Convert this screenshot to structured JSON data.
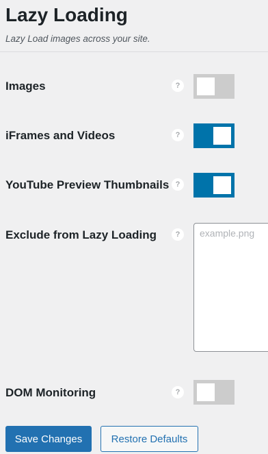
{
  "header": {
    "title": "Lazy Loading",
    "subtitle": "Lazy Load images across your site."
  },
  "settings": {
    "images": {
      "label": "Images",
      "help": "?",
      "enabled": false
    },
    "iframes_videos": {
      "label": "iFrames and Videos",
      "help": "?",
      "enabled": true
    },
    "youtube_thumbnails": {
      "label": "YouTube Preview Thumbnails",
      "help": "?",
      "enabled": true
    },
    "exclude": {
      "label": "Exclude from Lazy Loading",
      "help": "?",
      "value": "",
      "placeholder": "example.png"
    },
    "dom_monitoring": {
      "label": "DOM Monitoring",
      "help": "?",
      "enabled": false
    }
  },
  "actions": {
    "save_label": "Save Changes",
    "restore_label": "Restore Defaults"
  },
  "colors": {
    "toggle_on": "#0073aa",
    "toggle_off": "#cccccc",
    "primary": "#2271b1"
  }
}
